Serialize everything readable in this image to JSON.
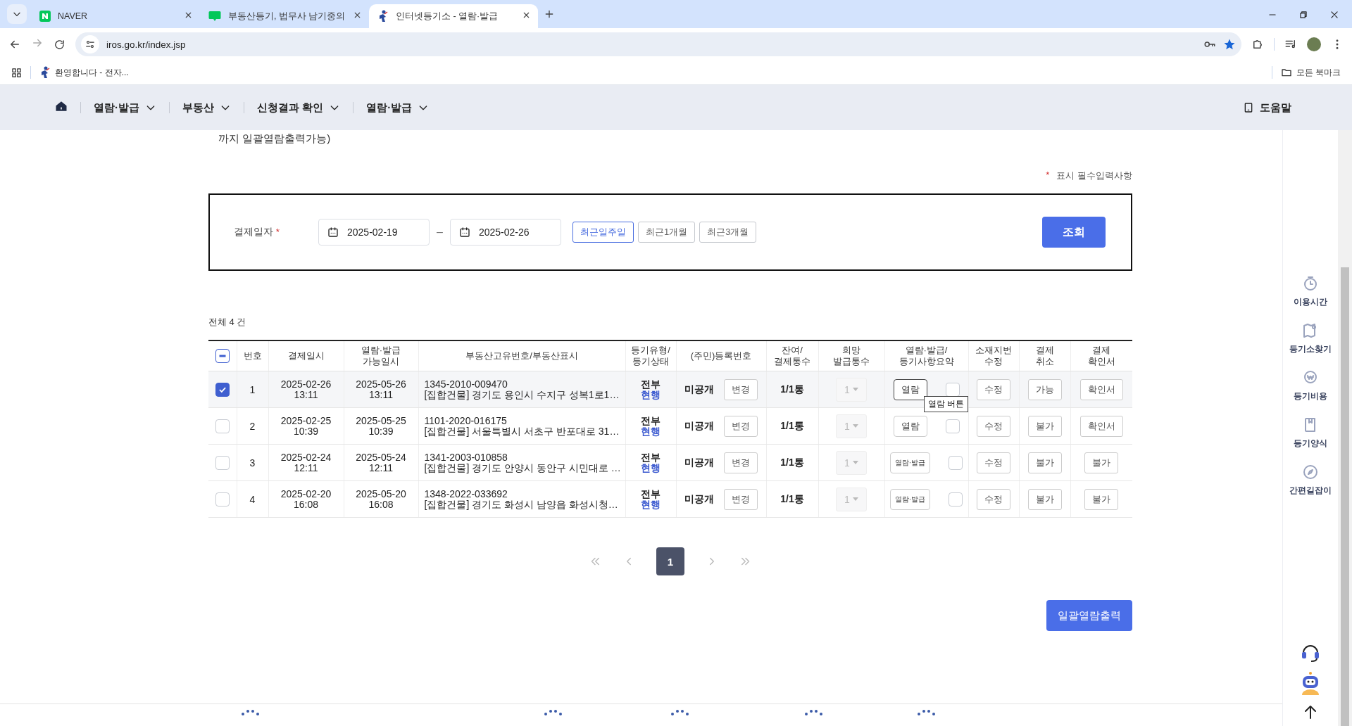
{
  "browser": {
    "tabs": [
      {
        "title": "NAVER",
        "selected": false
      },
      {
        "title": "부동산등기, 법무사 남기중의 ",
        "selected": false
      },
      {
        "title": "인터넷등기소 - 열람·발급",
        "selected": true
      }
    ],
    "url": "iros.go.kr/index.jsp",
    "bookmarks": [
      "환영합니다 - 전자..."
    ],
    "bookmarks_folder": "모든 북마크"
  },
  "nav": {
    "items": [
      "열람·발급",
      "부동산",
      "신청결과 확인",
      "열람·발급"
    ],
    "help": "도움말"
  },
  "notice": "까지 일괄열람출력가능)",
  "required_note": {
    "mark": "*",
    "text": "표시 필수입력사항"
  },
  "search": {
    "label": "결제일자",
    "required_mark": "*",
    "from": "2025-02-19",
    "separator": "–",
    "to": "2025-02-26",
    "periods": [
      {
        "label": "최근일주일",
        "selected": true
      },
      {
        "label": "최근1개월",
        "selected": false
      },
      {
        "label": "최근3개월",
        "selected": false
      }
    ],
    "submit": "조회"
  },
  "total": "전체 4 건",
  "table": {
    "select_all_partial": true,
    "columns": [
      "번호",
      "결제일시",
      "열람·발급\n가능일시",
      "부동산고유번호/부동산표시",
      "등기유형/\n등기상태",
      "(주민)등록번호",
      "잔여/\n결제통수",
      "희망\n발급통수",
      "열람·발급/\n등기사항요약",
      "소재지번\n수정",
      "결제\n취소",
      "결제\n확인서"
    ],
    "rows": [
      {
        "checked": true,
        "no": "1",
        "paid_date": "2025-02-26",
        "paid_time": "13:11",
        "until_date": "2025-05-26",
        "until_time": "13:11",
        "unique_no": "1345-2010-009470",
        "address": "[집합건물] 경기도 용인시 수지구 성복1로1…",
        "type": "전부",
        "status": "현행",
        "reg_no": "미공개",
        "change": "변경",
        "count": "1/1통",
        "copies": "1",
        "copies_disabled": true,
        "view": {
          "label": "열람",
          "kind": "view"
        },
        "summary_checked": false,
        "edit": "수정",
        "cancel": "가능",
        "receipt": "확인서"
      },
      {
        "checked": false,
        "no": "2",
        "paid_date": "2025-02-25",
        "paid_time": "10:39",
        "until_date": "2025-05-25",
        "until_time": "10:39",
        "unique_no": "1101-2020-016175",
        "address": "[집합건물] 서울특별시 서초구 반포대로 31…",
        "type": "전부",
        "status": "현행",
        "reg_no": "미공개",
        "change": "변경",
        "count": "1/1통",
        "copies": "1",
        "copies_disabled": true,
        "view": {
          "label": "열람",
          "kind": "view"
        },
        "summary_checked": false,
        "edit": "수정",
        "cancel": "불가",
        "receipt": "확인서"
      },
      {
        "checked": false,
        "no": "3",
        "paid_date": "2025-02-24",
        "paid_time": "12:11",
        "until_date": "2025-05-24",
        "until_time": "12:11",
        "unique_no": "1341-2003-010858",
        "address": "[집합건물] 경기도 안양시 동안구 시민대로 …",
        "type": "전부",
        "status": "현행",
        "reg_no": "미공개",
        "change": "변경",
        "count": "1/1통",
        "copies": "1",
        "copies_disabled": true,
        "view": {
          "label": "열람·발급",
          "kind": "issue"
        },
        "summary_checked": false,
        "edit": "수정",
        "cancel": "불가",
        "receipt": "불가"
      },
      {
        "checked": false,
        "no": "4",
        "paid_date": "2025-02-20",
        "paid_time": "16:08",
        "until_date": "2025-05-20",
        "until_time": "16:08",
        "unique_no": "1348-2022-033692",
        "address": "[집합건물] 경기도 화성시 남양읍 화성시청…",
        "type": "전부",
        "status": "현행",
        "reg_no": "미공개",
        "change": "변경",
        "count": "1/1통",
        "copies": "1",
        "copies_disabled": true,
        "view": {
          "label": "열람·발급",
          "kind": "issue"
        },
        "summary_checked": false,
        "edit": "수정",
        "cancel": "불가",
        "receipt": "불가"
      }
    ]
  },
  "tooltip": "열람 버튼",
  "pagination": {
    "pages": [
      {
        "label": "1",
        "selected": true
      }
    ]
  },
  "batch_button": "일괄열람출력",
  "side_menu": [
    {
      "label": "이용시간"
    },
    {
      "label": "등기소찾기"
    },
    {
      "label": "등기비용"
    },
    {
      "label": "등기양식"
    },
    {
      "label": "간편길잡이"
    }
  ]
}
